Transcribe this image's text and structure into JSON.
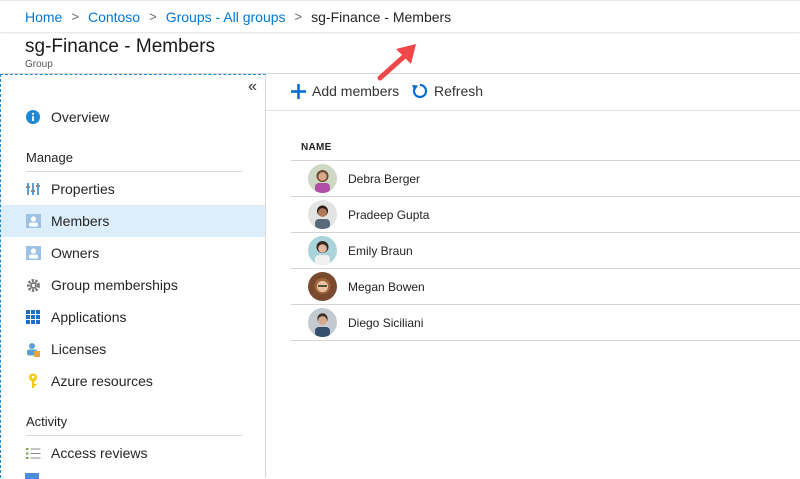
{
  "breadcrumb": {
    "items": [
      "Home",
      "Contoso",
      "Groups - All groups"
    ],
    "current": "sg-Finance - Members",
    "separator": ">"
  },
  "header": {
    "title": "sg-Finance - Members",
    "subtitle": "Group"
  },
  "sidebar": {
    "collapse_glyph": "«",
    "overview": "Overview",
    "manage_label": "Manage",
    "manage_items": [
      "Properties",
      "Members",
      "Owners",
      "Group memberships",
      "Applications",
      "Licenses",
      "Azure resources"
    ],
    "activity_label": "Activity",
    "activity_items": [
      "Access reviews"
    ],
    "active_item": "Members"
  },
  "toolbar": {
    "add_members": "Add members",
    "refresh": "Refresh"
  },
  "table": {
    "column_name": "NAME",
    "rows": [
      {
        "name": "Debra Berger",
        "avatar_color": "#8e6f8f"
      },
      {
        "name": "Pradeep Gupta",
        "avatar_color": "#6b4a3a"
      },
      {
        "name": "Emily Braun",
        "avatar_color": "#5c4a3c"
      },
      {
        "name": "Megan Bowen",
        "avatar_color": "#a0643c"
      },
      {
        "name": "Diego Siciliani",
        "avatar_color": "#4a5a6a"
      }
    ]
  },
  "colors": {
    "accent": "#0078d4",
    "active_bg": "#dcedfb",
    "arrow": "#f04848"
  },
  "icons": {
    "overview": "info-icon",
    "properties": "properties-icon",
    "members": "members-icon",
    "owners": "owners-icon",
    "group_memberships": "gear-icon",
    "applications": "grid-icon",
    "licenses": "license-icon",
    "azure_resources": "key-icon",
    "access_reviews": "checklist-icon",
    "add": "plus-icon",
    "refresh": "refresh-icon"
  }
}
